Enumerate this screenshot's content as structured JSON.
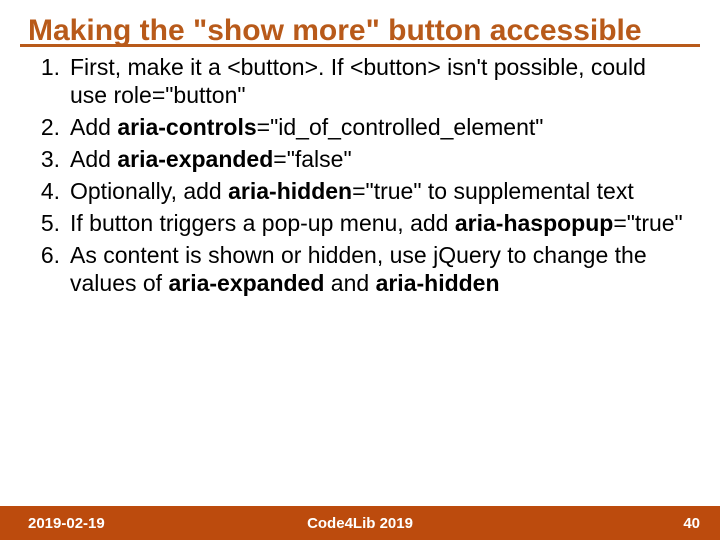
{
  "title": "Making the \"show more\" button accessible",
  "items": [
    {
      "n": "1.",
      "html": "First, make it a &lt;button&gt;. If &lt;button&gt; isn't possible, could use role=\"button\""
    },
    {
      "n": "2.",
      "html": "Add <span class='b'>aria-controls</span>=\"id_of_controlled_element\""
    },
    {
      "n": "3.",
      "html": "Add <span class='b'>aria-expanded</span>=\"false\""
    },
    {
      "n": "4.",
      "html": "Optionally, add <span class='b'>aria-hidden</span>=\"true\" to supplemental text"
    },
    {
      "n": "5.",
      "html": "If button triggers a pop-up menu, add <span class='b'>aria-haspopup</span>=\"true\""
    },
    {
      "n": "6.",
      "html": "As content is shown or hidden, use jQuery to change the values of <span class='b'>aria-expanded</span> and <span class='b'>aria-hidden</span>"
    }
  ],
  "footer": {
    "date": "2019-02-19",
    "event": "Code4Lib 2019",
    "page": "40"
  }
}
